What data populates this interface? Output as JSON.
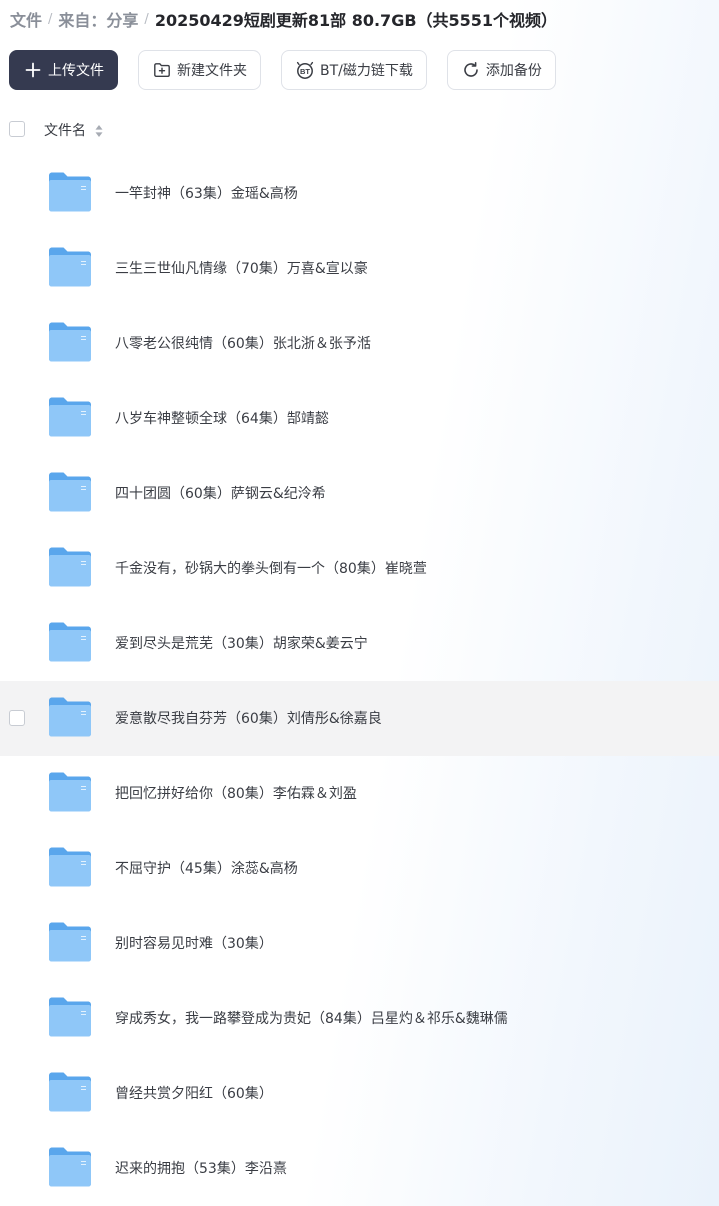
{
  "breadcrumb": {
    "items": [
      "文件",
      "来自：分享"
    ],
    "current": "20250429短剧更新81部 80.7GB（共5551个视频）"
  },
  "toolbar": {
    "upload": {
      "label": "上传文件",
      "icon": "plus-icon"
    },
    "new_folder": {
      "label": "新建文件夹",
      "icon": "folder-plus-icon"
    },
    "bt_magnet": {
      "label": "BT/磁力链下载",
      "icon": "bt-icon",
      "icon_text": "BT"
    },
    "add_backup": {
      "label": "添加备份",
      "icon": "sync-icon"
    }
  },
  "list": {
    "header": {
      "name_label": "文件名",
      "sort_icon": "sort-icon"
    },
    "hover_index": 7,
    "rows": [
      {
        "name": "一竿封神（63集）金瑶&高杨",
        "icon": "folder-icon"
      },
      {
        "name": "三生三世仙凡情缘（70集）万喜&宣以豪",
        "icon": "folder-icon"
      },
      {
        "name": "八零老公很纯情（60集）张北浙＆张予湉",
        "icon": "folder-icon"
      },
      {
        "name": "八岁车神整顿全球（64集）郜靖懿",
        "icon": "folder-icon"
      },
      {
        "name": "四十团圆（60集）萨钢云&纪泠希",
        "icon": "folder-icon"
      },
      {
        "name": "千金没有，砂锅大的拳头倒有一个（80集）崔晓萱",
        "icon": "folder-icon"
      },
      {
        "name": "爱到尽头是荒芜（30集）胡家荣&姜云宁",
        "icon": "folder-icon"
      },
      {
        "name": "爱意散尽我自芬芳（60集）刘倩彤&徐嘉良",
        "icon": "folder-icon"
      },
      {
        "name": "把回忆拼好给你（80集）李佑霖＆刘盈",
        "icon": "folder-icon"
      },
      {
        "name": "不屈守护（45集）涂蕊&高杨",
        "icon": "folder-icon"
      },
      {
        "name": "别时容易见时难（30集）",
        "icon": "folder-icon"
      },
      {
        "name": "穿成秀女，我一路攀登成为贵妃（84集）吕星灼＆祁乐&魏琳儒",
        "icon": "folder-icon"
      },
      {
        "name": "曾经共赏夕阳红（60集）",
        "icon": "folder-icon"
      },
      {
        "name": "迟来的拥抱（53集）李沿熹",
        "icon": "folder-icon"
      }
    ]
  },
  "colors": {
    "primary_button": "#353a50",
    "folder_back": "#5aa6ec",
    "folder_front": "#8fc7f8",
    "row_hover": "#f3f3f4"
  }
}
